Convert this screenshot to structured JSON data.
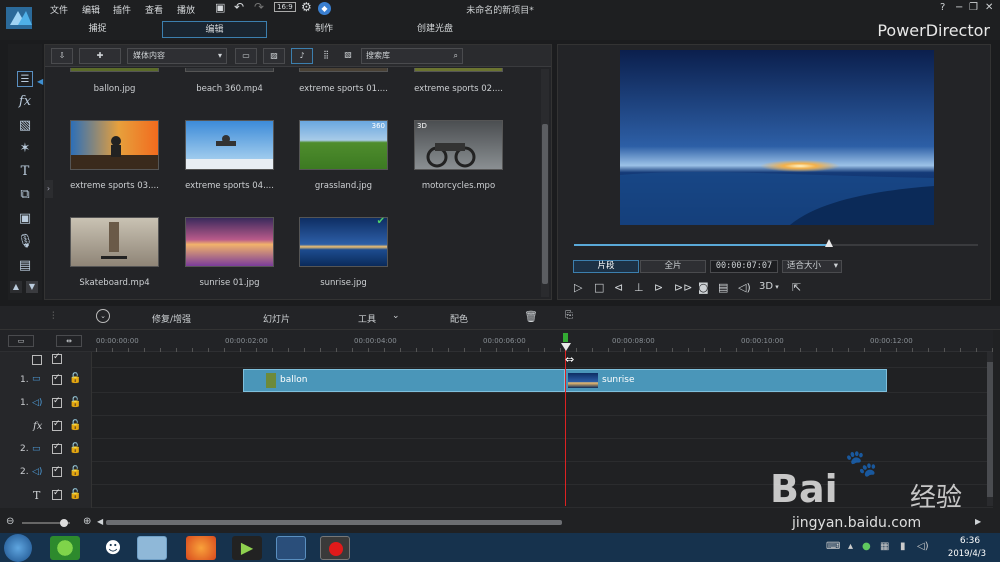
{
  "menu": {
    "items": [
      "文件",
      "编辑",
      "插件",
      "查看",
      "播放"
    ],
    "project_title": "未命名的新项目*",
    "app_name": "PowerDirector",
    "help": "?"
  },
  "mode_tabs": [
    "捕捉",
    "编辑",
    "制作",
    "创建光盘"
  ],
  "library": {
    "dropdown": "媒体内容",
    "search_placeholder": "搜索库",
    "row0": [
      "ballon.jpg",
      "beach 360.mp4",
      "extreme sports 01....",
      "extreme sports 02...."
    ],
    "items": [
      {
        "label": "extreme sports 03...."
      },
      {
        "label": "extreme sports 04...."
      },
      {
        "label": "grassland.jpg",
        "badge": "360"
      },
      {
        "label": "motorcycles.mpo",
        "badge": "3D"
      },
      {
        "label": "Skateboard.mp4"
      },
      {
        "label": "sunrise 01.jpg"
      },
      {
        "label": "sunrise.jpg"
      }
    ]
  },
  "preview": {
    "tab_clip": "片段",
    "tab_full": "全片",
    "timecode": "00:00:07:07",
    "fit": "适合大小",
    "mode_3d": "3D",
    "progress": 0.63
  },
  "timeline_toolbar": {
    "enhance": "修复/增强",
    "slideshow": "幻灯片",
    "tools": "工具",
    "color": "配色"
  },
  "ruler": [
    "00:00:00:00",
    "00:00:02:00",
    "00:00:04:00",
    "00:00:06:00",
    "00:00:08:00",
    "00:00:10:00",
    "00:00:12:00"
  ],
  "tracks": [
    {
      "label": ""
    },
    {
      "label": "1."
    },
    {
      "label": "1."
    },
    {
      "label": ""
    },
    {
      "label": "2."
    },
    {
      "label": "2."
    },
    {
      "label": ""
    }
  ],
  "clips": [
    {
      "label": "ballon"
    },
    {
      "label": "sunrise"
    }
  ],
  "tray": {
    "time": "6:36",
    "date": "2019/4/3"
  },
  "watermark": {
    "brand": "Bai",
    "site": "jingyan.baidu.com",
    "cn": "经验"
  }
}
